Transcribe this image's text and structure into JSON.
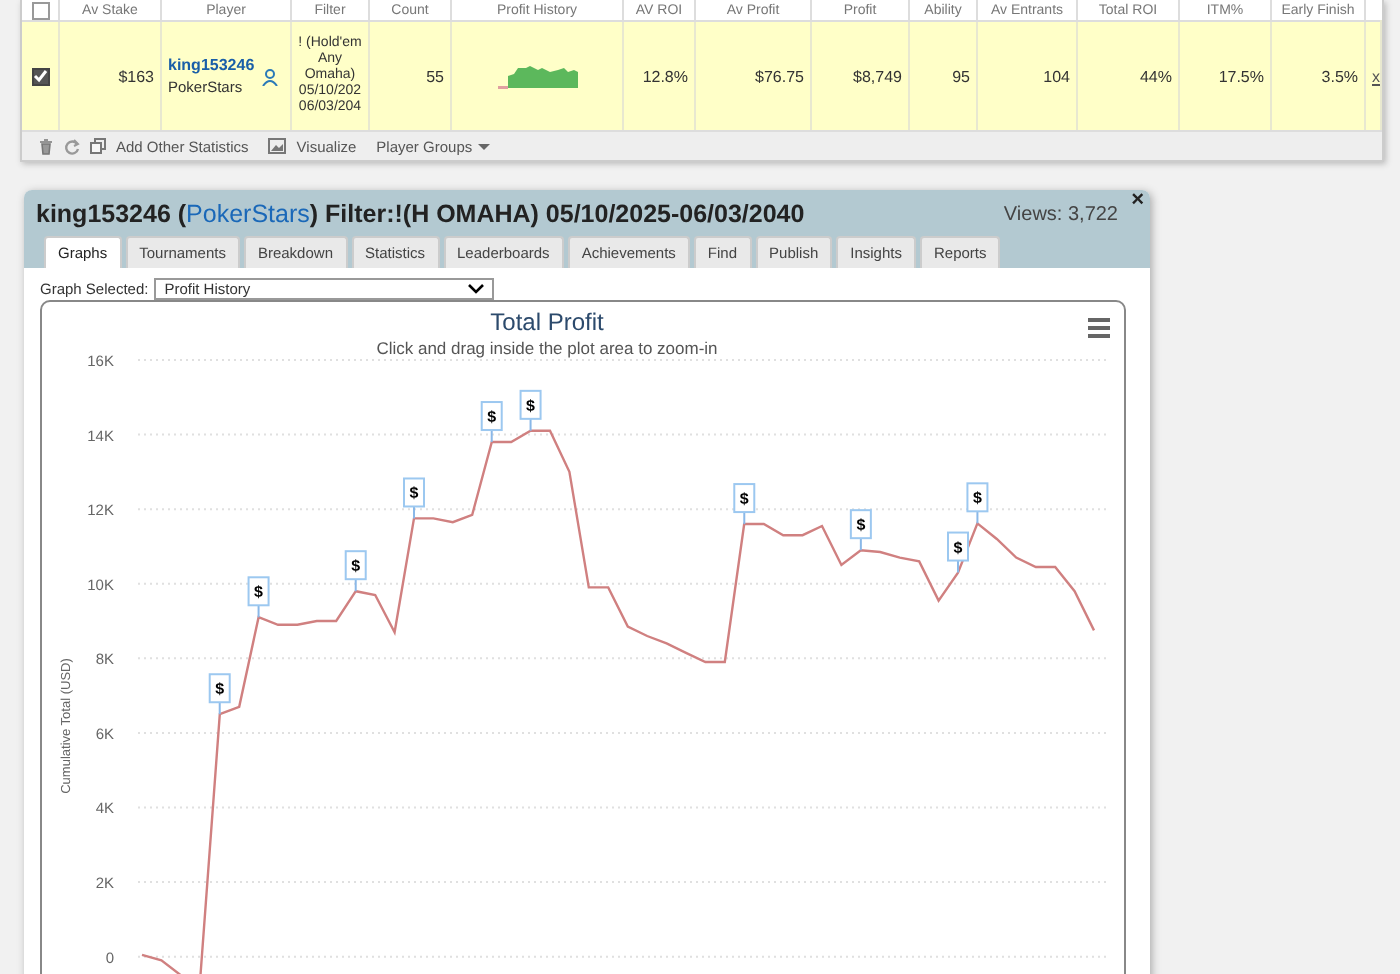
{
  "stats_table": {
    "header_checked": false,
    "columns": [
      "Av Stake",
      "Player",
      "Filter",
      "Count",
      "Profit History",
      "AV ROI",
      "Av Profit",
      "Profit",
      "Ability",
      "Av Entrants",
      "Total ROI",
      "ITM%",
      "Early Finish"
    ],
    "rows": [
      {
        "checked": true,
        "av_stake": "$163",
        "player": "king153246",
        "site": "PokerStars",
        "filter": "! (Hold'em Any Omaha) 05/10/202 06/03/204",
        "count": "55",
        "av_roi": "12.8%",
        "av_profit": "$76.75",
        "profit": "$8,749",
        "ability": "95",
        "av_entrants": "104",
        "total_roi": "44%",
        "itm": "17.5%",
        "early_finish": "3.5%",
        "remove": "x"
      }
    ]
  },
  "toolbar": [
    {
      "kind": "delete"
    },
    {
      "kind": "refresh"
    },
    {
      "kind": "add",
      "label": "Add Other Statistics"
    },
    {
      "kind": "visualize",
      "label": "Visualize"
    },
    {
      "kind": "groups",
      "label": "Player Groups"
    }
  ],
  "panel": {
    "title_before": "king153246 (",
    "title_link": "PokerStars",
    "title_after": ") Filter:!(H OMAHA) 05/10/2025-06/03/2040",
    "views": "Views: 3,722",
    "close": "×",
    "tabs": [
      {
        "label": "Graphs",
        "selected": true
      },
      {
        "label": "Tournaments",
        "selected": false
      },
      {
        "label": "Breakdown",
        "selected": false
      },
      {
        "label": "Statistics",
        "selected": false
      },
      {
        "label": "Leaderboards",
        "selected": false
      },
      {
        "label": "Achievements",
        "selected": false
      },
      {
        "label": "Find",
        "selected": false
      },
      {
        "label": "Publish",
        "selected": false
      },
      {
        "label": "Insights",
        "selected": false
      },
      {
        "label": "Reports",
        "selected": false
      }
    ],
    "graph_select_label": "Graph Selected:",
    "graph_select_value": "Profit History",
    "chart_data": {
      "type": "line",
      "title": "Total Profit",
      "subtitle": "Click and drag inside the plot area to zoom-in",
      "ylabel": "Cumulative Total (USD)",
      "grid": true,
      "ylim": [
        -600,
        16000
      ],
      "yticks": [
        {
          "value": 0,
          "label": "0"
        },
        {
          "value": 2000,
          "label": "2K"
        },
        {
          "value": 4000,
          "label": "4K"
        },
        {
          "value": 6000,
          "label": "6K"
        },
        {
          "value": 8000,
          "label": "8K"
        },
        {
          "value": 10000,
          "label": "10K"
        },
        {
          "value": 12000,
          "label": "12K"
        },
        {
          "value": 14000,
          "label": "14K"
        },
        {
          "value": 16000,
          "label": "16K"
        }
      ],
      "series": [
        {
          "color": "#d08080",
          "values": [
            50,
            -100,
            -500,
            -600,
            6500,
            6700,
            9100,
            8900,
            8900,
            9000,
            9000,
            9800,
            9700,
            8700,
            11750,
            11750,
            11650,
            11850,
            13800,
            13800,
            14100,
            14100,
            13000,
            9900,
            9900,
            8850,
            8600,
            8400,
            8150,
            7900,
            7900,
            11600,
            11600,
            11300,
            11300,
            11550,
            10500,
            10900,
            10850,
            10700,
            10600,
            9550,
            10300,
            11620,
            11200,
            10700,
            10450,
            10450,
            9800,
            8750
          ]
        }
      ],
      "annotations": [
        {
          "y": 6500,
          "text": "$"
        },
        {
          "y": 9100,
          "text": "$"
        },
        {
          "y": 9800,
          "text": "$"
        },
        {
          "y": 11750,
          "text": "$"
        },
        {
          "y": 13800,
          "text": "$"
        },
        {
          "y": 14100,
          "text": "$"
        },
        {
          "y": 11600,
          "text": "$"
        },
        {
          "y": 10900,
          "text": "$"
        },
        {
          "y": 10300,
          "text": "$"
        },
        {
          "y": 11620,
          "text": "$"
        }
      ]
    }
  }
}
